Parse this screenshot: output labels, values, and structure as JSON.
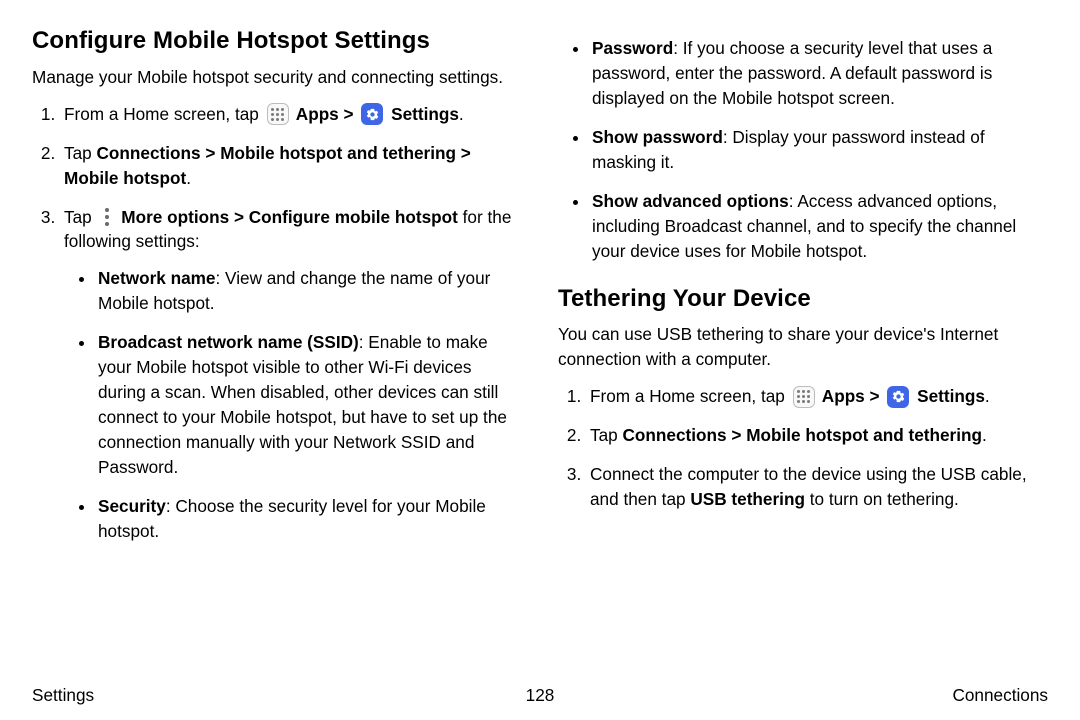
{
  "left": {
    "heading": "Configure Mobile Hotspot Settings",
    "intro": "Manage your Mobile hotspot security and connecting settings.",
    "step1_a": "From a Home screen, tap ",
    "step1_b": " Apps",
    "step1_c": " Settings",
    "step2_a": "Tap ",
    "step2_b": "Connections",
    "step2_c": "Mobile hotspot and tethering",
    "step2_d": "Mobile hotspot",
    "step3_a": "Tap ",
    "step3_b": " More options",
    "step3_c": "Configure mobile hotspot",
    "step3_d": " for the following settings:",
    "b1_k": "Network name",
    "b1_v": ": View and change the name of your Mobile hotspot.",
    "b2_k": "Broadcast network name (SSID)",
    "b2_v": ": Enable to make your Mobile hotspot visible to other Wi‑Fi devices during a scan. When disabled, other devices can still connect to your Mobile hotspot, but have to set up the connection manually with your Network SSID and Password.",
    "b3_k": "Security",
    "b3_v": ": Choose the security level for your Mobile hotspot."
  },
  "right": {
    "b4_k": "Password",
    "b4_v": ": If you choose a security level that uses a password, enter the password. A default password is displayed on the Mobile hotspot screen.",
    "b5_k": "Show password",
    "b5_v": ": Display your password instead of masking it.",
    "b6_k": "Show advanced options",
    "b6_v": ": Access advanced options, including Broadcast channel, and to specify the channel your device uses for Mobile hotspot.",
    "heading2": "Tethering Your Device",
    "intro2": "You can use USB tethering to share your device's Internet connection with a computer.",
    "t1_a": "From a Home screen, tap ",
    "t1_b": " Apps",
    "t1_c": " Settings",
    "t2_a": "Tap ",
    "t2_b": "Connections",
    "t2_c": "Mobile hotspot and tethering",
    "t3_a": "Connect the computer to the device using the USB cable, and then tap ",
    "t3_b": "USB tethering",
    "t3_c": " to turn on tethering."
  },
  "chev": " > ",
  "dot": ".",
  "footer": {
    "left": "Settings",
    "center": "128",
    "right": "Connections"
  }
}
